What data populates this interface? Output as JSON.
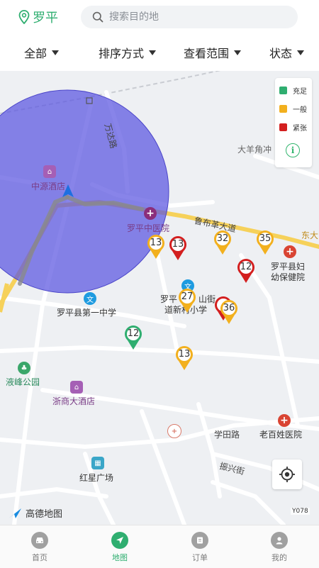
{
  "header": {
    "city": "罗平",
    "search_placeholder": "搜索目的地"
  },
  "filters": [
    {
      "label": "全部"
    },
    {
      "label": "排序方式"
    },
    {
      "label": "查看范围"
    },
    {
      "label": "状态"
    }
  ],
  "legend": {
    "items": [
      {
        "label": "充足",
        "color": "#2fae70"
      },
      {
        "label": "一般",
        "color": "#f2b01e"
      },
      {
        "label": "紧张",
        "color": "#d31f1f"
      }
    ],
    "info_icon": "info-icon"
  },
  "map": {
    "labels": {
      "wanda_road": "万达路",
      "dayang_jiaochong": "大羊角冲",
      "zhongyuan_hotel": "中源酒店",
      "luoping_tcm_hospital": "罗平中医院",
      "lubuge_avenue": "鲁布革大道",
      "dongda": "东大",
      "maternal_hospital_1": "罗平县妇",
      "maternal_hospital_2": "幼保健院",
      "luoping_no1_middle": "罗平县第一中学",
      "school_1": "罗平",
      "school_1b": "山街",
      "school_2": "道新村小学",
      "yefeng_park": "液峰公园",
      "zheshang_hotel": "浙商大酒店",
      "xuetian_road": "学田路",
      "laobaixing_hospital": "老百姓医院",
      "zhenxing_street": "振兴街",
      "hongxing_square": "红星广场",
      "amap": "高德地图",
      "y078": "Y078"
    },
    "pins": [
      {
        "value": "13",
        "status": "一般"
      },
      {
        "value": "13",
        "status": "紧张"
      },
      {
        "value": "32",
        "status": "一般"
      },
      {
        "value": "35",
        "status": "一般"
      },
      {
        "value": "12",
        "status": "紧张"
      },
      {
        "value": "27",
        "status": "一般"
      },
      {
        "value": "36",
        "status": "一般"
      },
      {
        "value": "12",
        "status": "充足"
      },
      {
        "value": "13",
        "status": "一般"
      }
    ],
    "range_circle_color": "#5a55e0"
  },
  "tabbar": {
    "items": [
      {
        "label": "首页",
        "icon": "car-icon"
      },
      {
        "label": "地图",
        "icon": "navigation-icon"
      },
      {
        "label": "订单",
        "icon": "order-icon"
      },
      {
        "label": "我的",
        "icon": "user-icon"
      }
    ],
    "active_index": 1,
    "active_color": "#2fae70",
    "inactive_color": "#9a9a9a"
  }
}
